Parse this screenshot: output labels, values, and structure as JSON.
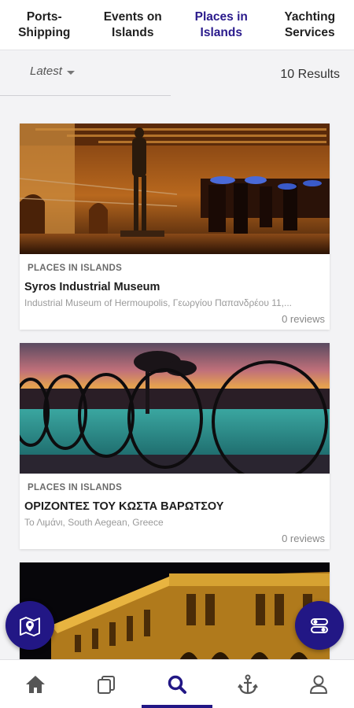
{
  "tabs": [
    {
      "label": "Ports-\nShipping"
    },
    {
      "label": "Events on\nIslands"
    },
    {
      "label": "Places in\nIslands"
    },
    {
      "label": "Yachting\nServices"
    }
  ],
  "filter": {
    "sort_label": "Latest",
    "results": "10 Results"
  },
  "listings": [
    {
      "category": "PLACES IN ISLANDS",
      "title": "Syros Industrial Museum",
      "address": "Industrial Museum of Hermoupolis, Γεωργίου Παπανδρέου 11,...",
      "reviews": "0 reviews"
    },
    {
      "category": "PLACES IN ISLANDS",
      "title": "ΟΡΙΖΟΝΤΕΣ ΤΟΥ ΚΩΣΤΑ ΒΑΡΩΤΣΟΥ",
      "address": "Το Λιμάνι, South Aegean, Greece",
      "reviews": "0 reviews"
    }
  ],
  "fabs": {
    "map_icon": "map-pin-icon",
    "filter_icon": "toggles-icon"
  },
  "bottom_nav": [
    "home-icon",
    "copy-icon",
    "search-icon",
    "anchor-icon",
    "user-icon"
  ],
  "colors": {
    "accent": "#221785",
    "active_tab": "#2a1a8c"
  }
}
